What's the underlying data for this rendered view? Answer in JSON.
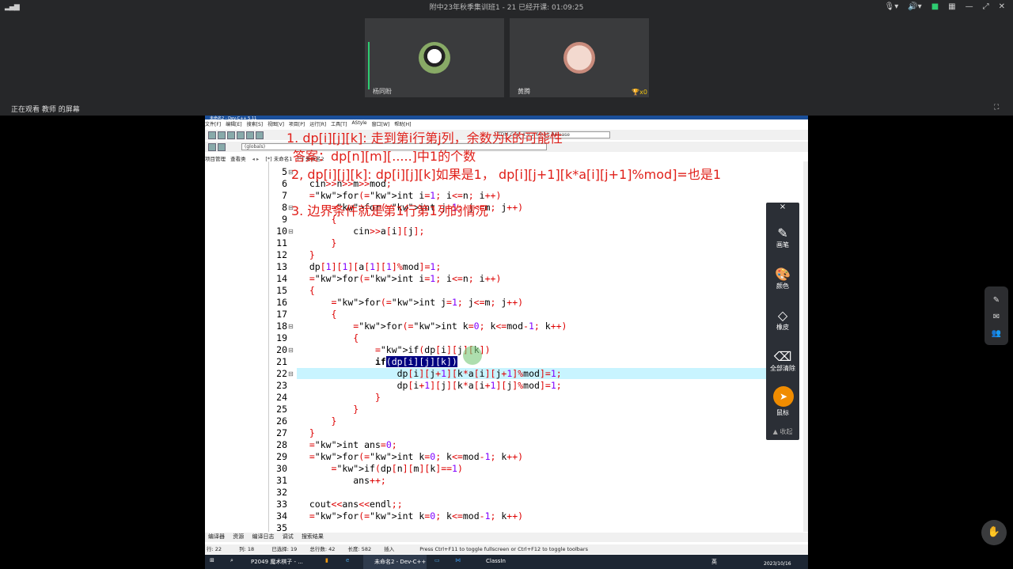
{
  "meeting": {
    "title": "附中23年秋季集训班1 - 21   已经开课: 01:09:25",
    "signal_icon": "signal-bars-icon",
    "sharing_label": "正在观看 教师 的屏幕"
  },
  "participants": [
    {
      "name": "杨同盼",
      "avatar": "panda"
    },
    {
      "name": "黄腾",
      "avatar": "cat",
      "trophy": "x0"
    }
  ],
  "ide": {
    "window_title": "未命名2 - Dev-C++ 5.11",
    "menus": [
      "文件[F]",
      "编辑[E]",
      "搜索[S]",
      "视图[V]",
      "项目[P]",
      "运行[R]",
      "工具[T]",
      "AStyle",
      "窗口[W]",
      "帮助[H]"
    ],
    "compiler_combo": "TDM-GCC 4.9.2 64-bit Release",
    "scope_combo": "(globals)",
    "panel_tabs": [
      "项目管理",
      "查看类"
    ],
    "file_tabs": [
      "[*] 未命名1",
      "[*] 未命名2"
    ],
    "lines": [
      {
        "n": "5"
      },
      {
        "n": "6"
      },
      {
        "n": "7"
      },
      {
        "n": "8"
      },
      {
        "n": "9"
      },
      {
        "n": "10"
      },
      {
        "n": "11"
      },
      {
        "n": "12"
      },
      {
        "n": "13"
      },
      {
        "n": "14"
      },
      {
        "n": "15"
      },
      {
        "n": "16"
      },
      {
        "n": "17"
      },
      {
        "n": "18"
      },
      {
        "n": "19"
      },
      {
        "n": "20"
      },
      {
        "n": "21"
      },
      {
        "n": "22"
      },
      {
        "n": "23"
      },
      {
        "n": "24"
      },
      {
        "n": "25"
      },
      {
        "n": "26"
      },
      {
        "n": "27"
      },
      {
        "n": "28"
      },
      {
        "n": "29"
      },
      {
        "n": "30"
      },
      {
        "n": "31"
      },
      {
        "n": "32"
      },
      {
        "n": "33"
      },
      {
        "n": "34"
      },
      {
        "n": "35"
      }
    ],
    "bottom_tabs": [
      "编译器",
      "资源",
      "编译日志",
      "调试",
      "搜索结果"
    ],
    "status": {
      "line": "行: 22",
      "col": "列: 18",
      "selected": "已选择: 19",
      "total": "总行数: 42",
      "length": "长度: 582",
      "mode": "插入",
      "hint": "Press Ctrl+F11 to toggle fullscreen or Ctrl+F12 to toggle toolbars"
    }
  },
  "annotations": [
    "1. dp[i][j][k]: 走到第i行第j列，余数为k的可能性",
    "答案：dp[n][m][.....]中1的个数",
    "2, dp[i][j][k]: dp[i][j][k]如果是1，  dp[i][j+1][k*a[i][j+1]%mod]=也是1",
    "3. 边界条件就是第1行第1列的情况"
  ],
  "pen_panel": {
    "close": "×",
    "tools": [
      {
        "label": "画笔",
        "icon": "brush-icon"
      },
      {
        "label": "颜色",
        "icon": "palette-icon"
      },
      {
        "label": "橡皮",
        "icon": "eraser-icon"
      },
      {
        "label": "全部清除",
        "icon": "clear-all-icon"
      },
      {
        "label": "鼠标",
        "icon": "mouse-pointer-icon"
      }
    ],
    "collapse": "▲ 收起"
  },
  "taskbar": {
    "items": [
      "P2049 魔术棋子 - ...",
      "未命名2 - Dev-C++",
      "ClassIn"
    ],
    "tray_lang": "英",
    "clock_date": "2023/10/16"
  },
  "colors": {
    "annotation": "#e0201a",
    "selection": "#000080",
    "current_line": "#c8f4ff",
    "tool_active": "#f08c00"
  }
}
